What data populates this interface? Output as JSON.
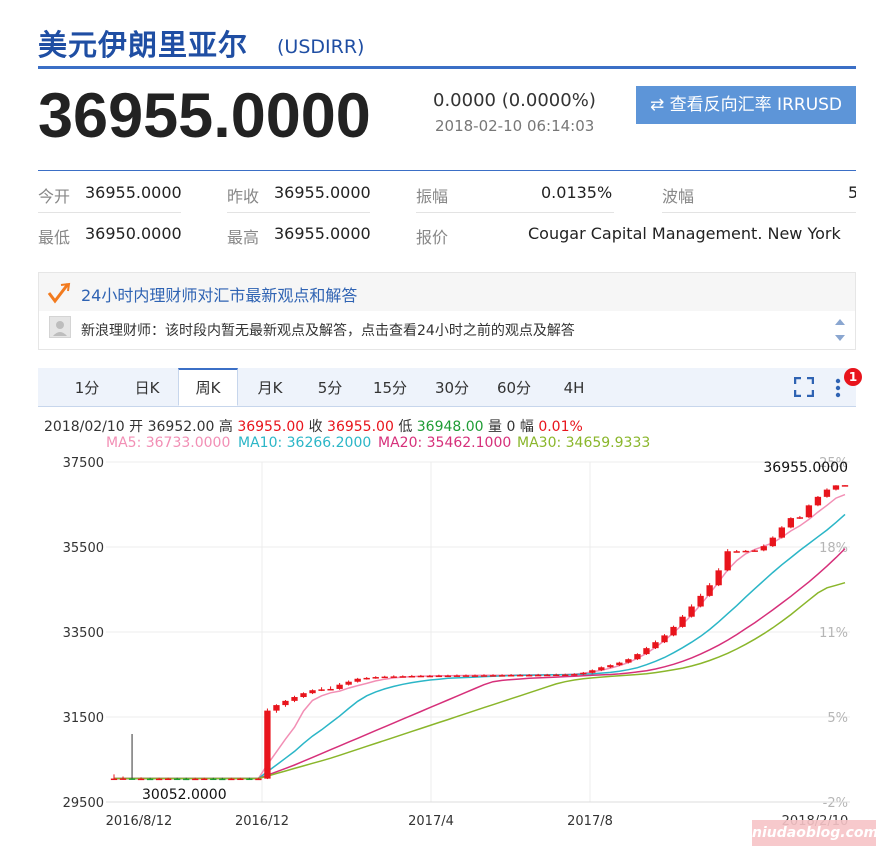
{
  "header": {
    "title": "美元伊朗里亚尔",
    "code": "(USDIRR)",
    "price": "36955.0000",
    "change": "0.0000 (0.0000%)",
    "timestamp": "2018-02-10 06:14:03",
    "reverse_button": "查看反向汇率 IRRUSD"
  },
  "stats": {
    "row1": [
      {
        "label": "今开",
        "value": "36955.0000"
      },
      {
        "label": "昨收",
        "value": "36955.0000"
      },
      {
        "label": "振幅",
        "value": "0.0135%"
      },
      {
        "label": "波幅",
        "value": "5"
      }
    ],
    "row2": [
      {
        "label": "最低",
        "value": "36950.0000"
      },
      {
        "label": "最高",
        "value": "36955.0000"
      },
      {
        "label": "报价",
        "value": "Cougar Capital Management. New York"
      }
    ]
  },
  "advice": {
    "title": "24小时内理财师对汇市最新观点和解答",
    "text": "新浪理财师：该时段内暂无最新观点及解答，点击查看24小时之前的观点及解答"
  },
  "tabs": [
    "1分",
    "日K",
    "周K",
    "月K",
    "5分",
    "15分",
    "30分",
    "60分",
    "4H"
  ],
  "active_tab": "周K",
  "notification_count": "1",
  "ohlc": {
    "date": "2018/02/10",
    "open_label": "开",
    "open": "36952.00",
    "high_label": "高",
    "high": "36955.00",
    "close_label": "收",
    "close": "36955.00",
    "low_label": "低",
    "low": "36948.00",
    "volume_label": "量",
    "volume": "0",
    "range_label": "幅",
    "range": "0.01%"
  },
  "ma_legend": [
    {
      "label": "MA5: 36733.0000",
      "color": "#f28fb5"
    },
    {
      "label": "MA10: 36266.2000",
      "color": "#2bb6c7"
    },
    {
      "label": "MA20: 35462.1000",
      "color": "#d6307a"
    },
    {
      "label": "MA30: 34659.9333",
      "color": "#8ab62b"
    }
  ],
  "colors": {
    "up": "#e8141c",
    "down": "#1f9c35",
    "accent": "#3b6fc6"
  },
  "chart_data": {
    "type": "candlestick",
    "y_ticks": [
      "37500",
      "35500",
      "33500",
      "31500",
      "29500"
    ],
    "ylim": [
      29500,
      37500
    ],
    "pct_ticks": [
      "25%",
      "18%",
      "11%",
      "5%",
      "-2%"
    ],
    "x_ticks": [
      "2016/8/12",
      "2016/12",
      "2017/4",
      "2017/8",
      "2018/2/10"
    ],
    "max_label": "36955.0000",
    "min_label": "30052.0000",
    "grid": true,
    "candles": [
      {
        "o": 30052,
        "h": 30150,
        "l": 30030,
        "c": 30052
      },
      {
        "o": 30052,
        "h": 30100,
        "l": 30040,
        "c": 30055
      },
      {
        "o": 30055,
        "h": 31100,
        "l": 30040,
        "c": 30050
      },
      {
        "o": 30050,
        "h": 30080,
        "l": 30030,
        "c": 30050
      },
      {
        "o": 30050,
        "h": 30070,
        "l": 30030,
        "c": 30048
      },
      {
        "o": 30048,
        "h": 30070,
        "l": 30030,
        "c": 30050
      },
      {
        "o": 30050,
        "h": 30070,
        "l": 30030,
        "c": 30052
      },
      {
        "o": 30052,
        "h": 30070,
        "l": 30030,
        "c": 30050
      },
      {
        "o": 30050,
        "h": 30070,
        "l": 30030,
        "c": 30048
      },
      {
        "o": 30048,
        "h": 30070,
        "l": 30030,
        "c": 30050
      },
      {
        "o": 30050,
        "h": 30070,
        "l": 30030,
        "c": 30052
      },
      {
        "o": 30052,
        "h": 30070,
        "l": 30030,
        "c": 30050
      },
      {
        "o": 30050,
        "h": 30070,
        "l": 30030,
        "c": 30048
      },
      {
        "o": 30048,
        "h": 30070,
        "l": 30030,
        "c": 30050
      },
      {
        "o": 30050,
        "h": 30070,
        "l": 30030,
        "c": 30052
      },
      {
        "o": 30052,
        "h": 30070,
        "l": 30030,
        "c": 30050
      },
      {
        "o": 30050,
        "h": 30070,
        "l": 30030,
        "c": 30050
      },
      {
        "o": 30050,
        "h": 31700,
        "l": 30040,
        "c": 31650
      },
      {
        "o": 31650,
        "h": 31800,
        "l": 31600,
        "c": 31780
      },
      {
        "o": 31780,
        "h": 31900,
        "l": 31740,
        "c": 31880
      },
      {
        "o": 31880,
        "h": 32000,
        "l": 31850,
        "c": 31970
      },
      {
        "o": 31970,
        "h": 32080,
        "l": 31950,
        "c": 32060
      },
      {
        "o": 32060,
        "h": 32150,
        "l": 32040,
        "c": 32130
      },
      {
        "o": 32130,
        "h": 32200,
        "l": 32110,
        "c": 32150
      },
      {
        "o": 32150,
        "h": 32220,
        "l": 32130,
        "c": 32160
      },
      {
        "o": 32160,
        "h": 32300,
        "l": 32140,
        "c": 32260
      },
      {
        "o": 32260,
        "h": 32360,
        "l": 32240,
        "c": 32330
      },
      {
        "o": 32330,
        "h": 32420,
        "l": 32310,
        "c": 32400
      },
      {
        "o": 32400,
        "h": 32440,
        "l": 32380,
        "c": 32420
      },
      {
        "o": 32420,
        "h": 32460,
        "l": 32400,
        "c": 32440
      },
      {
        "o": 32440,
        "h": 32470,
        "l": 32420,
        "c": 32450
      },
      {
        "o": 32450,
        "h": 32480,
        "l": 32430,
        "c": 32455
      },
      {
        "o": 32455,
        "h": 32480,
        "l": 32430,
        "c": 32460
      },
      {
        "o": 32460,
        "h": 32490,
        "l": 32440,
        "c": 32465
      },
      {
        "o": 32465,
        "h": 32490,
        "l": 32440,
        "c": 32470
      },
      {
        "o": 32470,
        "h": 32490,
        "l": 32450,
        "c": 32470
      },
      {
        "o": 32470,
        "h": 32495,
        "l": 32450,
        "c": 32475
      },
      {
        "o": 32475,
        "h": 32495,
        "l": 32455,
        "c": 32475
      },
      {
        "o": 32475,
        "h": 32500,
        "l": 32455,
        "c": 32478
      },
      {
        "o": 32478,
        "h": 32500,
        "l": 32460,
        "c": 32480
      },
      {
        "o": 32480,
        "h": 32500,
        "l": 32460,
        "c": 32480
      },
      {
        "o": 32480,
        "h": 32505,
        "l": 32460,
        "c": 32482
      },
      {
        "o": 32482,
        "h": 32505,
        "l": 32460,
        "c": 32485
      },
      {
        "o": 32485,
        "h": 32505,
        "l": 32465,
        "c": 32485
      },
      {
        "o": 32485,
        "h": 32510,
        "l": 32465,
        "c": 32488
      },
      {
        "o": 32488,
        "h": 32510,
        "l": 32470,
        "c": 32490
      },
      {
        "o": 32490,
        "h": 32510,
        "l": 32470,
        "c": 32490
      },
      {
        "o": 32490,
        "h": 32515,
        "l": 32470,
        "c": 32492
      },
      {
        "o": 32492,
        "h": 32515,
        "l": 32470,
        "c": 32495
      },
      {
        "o": 32495,
        "h": 32520,
        "l": 32475,
        "c": 32498
      },
      {
        "o": 32498,
        "h": 32520,
        "l": 32475,
        "c": 32500
      },
      {
        "o": 32500,
        "h": 32530,
        "l": 32480,
        "c": 32510
      },
      {
        "o": 32510,
        "h": 32560,
        "l": 32490,
        "c": 32540
      },
      {
        "o": 32540,
        "h": 32620,
        "l": 32520,
        "c": 32600
      },
      {
        "o": 32600,
        "h": 32690,
        "l": 32580,
        "c": 32670
      },
      {
        "o": 32670,
        "h": 32740,
        "l": 32650,
        "c": 32720
      },
      {
        "o": 32720,
        "h": 32800,
        "l": 32700,
        "c": 32780
      },
      {
        "o": 32780,
        "h": 32880,
        "l": 32760,
        "c": 32860
      },
      {
        "o": 32860,
        "h": 33000,
        "l": 32840,
        "c": 32980
      },
      {
        "o": 32980,
        "h": 33150,
        "l": 32960,
        "c": 33120
      },
      {
        "o": 33120,
        "h": 33300,
        "l": 33100,
        "c": 33260
      },
      {
        "o": 33260,
        "h": 33450,
        "l": 33240,
        "c": 33420
      },
      {
        "o": 33420,
        "h": 33650,
        "l": 33400,
        "c": 33620
      },
      {
        "o": 33620,
        "h": 33900,
        "l": 33600,
        "c": 33860
      },
      {
        "o": 33860,
        "h": 34150,
        "l": 33840,
        "c": 34100
      },
      {
        "o": 34100,
        "h": 34400,
        "l": 34080,
        "c": 34350
      },
      {
        "o": 34350,
        "h": 34650,
        "l": 34330,
        "c": 34600
      },
      {
        "o": 34600,
        "h": 35000,
        "l": 34580,
        "c": 34950
      },
      {
        "o": 34950,
        "h": 35450,
        "l": 34930,
        "c": 35400
      },
      {
        "o": 35400,
        "h": 35430,
        "l": 35380,
        "c": 35400
      },
      {
        "o": 35400,
        "h": 35430,
        "l": 35380,
        "c": 35410
      },
      {
        "o": 35410,
        "h": 35440,
        "l": 35390,
        "c": 35420
      },
      {
        "o": 35420,
        "h": 35560,
        "l": 35400,
        "c": 35520
      },
      {
        "o": 35520,
        "h": 35750,
        "l": 35500,
        "c": 35720
      },
      {
        "o": 35720,
        "h": 35990,
        "l": 35700,
        "c": 35960
      },
      {
        "o": 35960,
        "h": 36200,
        "l": 35940,
        "c": 36180
      },
      {
        "o": 36180,
        "h": 36230,
        "l": 36160,
        "c": 36200
      },
      {
        "o": 36200,
        "h": 36500,
        "l": 36180,
        "c": 36480
      },
      {
        "o": 36480,
        "h": 36700,
        "l": 36460,
        "c": 36680
      },
      {
        "o": 36680,
        "h": 36880,
        "l": 36660,
        "c": 36850
      },
      {
        "o": 36850,
        "h": 36955,
        "l": 36830,
        "c": 36950
      },
      {
        "o": 36952,
        "h": 36955,
        "l": 36948,
        "c": 36955
      }
    ],
    "series": [
      {
        "name": "MA5",
        "color": "#f28fb5",
        "values": [
          30052,
          30052,
          30052,
          30052,
          30052,
          30052,
          30052,
          30052,
          30052,
          30052,
          30052,
          30052,
          30052,
          30052,
          30052,
          30052,
          30052,
          30380,
          30680,
          30980,
          31260,
          31640,
          31890,
          32000,
          32070,
          32110,
          32180,
          32240,
          32290,
          32350,
          32390,
          32420,
          32440,
          32450,
          32460,
          32465,
          32470,
          32472,
          32475,
          32477,
          32478,
          32480,
          32482,
          32484,
          32486,
          32488,
          32490,
          32492,
          32494,
          32496,
          32500,
          32510,
          32530,
          32560,
          32600,
          32650,
          32710,
          32780,
          32880,
          33000,
          33140,
          33300,
          33480,
          33680,
          33900,
          34140,
          34400,
          34680,
          34960,
          35180,
          35340,
          35440,
          35520,
          35600,
          35730,
          35880,
          36000,
          36150,
          36320,
          36480,
          36650,
          36733
        ]
      },
      {
        "name": "MA10",
        "color": "#2bb6c7",
        "values": [
          30052,
          30052,
          30052,
          30052,
          30052,
          30052,
          30052,
          30052,
          30052,
          30052,
          30052,
          30052,
          30052,
          30052,
          30052,
          30052,
          30052,
          30215,
          30370,
          30530,
          30690,
          30880,
          31050,
          31200,
          31360,
          31520,
          31700,
          31870,
          32000,
          32090,
          32160,
          32220,
          32270,
          32310,
          32340,
          32370,
          32390,
          32410,
          32420,
          32430,
          32440,
          32450,
          32460,
          32468,
          32474,
          32480,
          32484,
          32487,
          32490,
          32493,
          32496,
          32500,
          32508,
          32518,
          32532,
          32550,
          32578,
          32612,
          32660,
          32730,
          32810,
          32900,
          33010,
          33130,
          33260,
          33400,
          33560,
          33740,
          33930,
          34120,
          34320,
          34520,
          34710,
          34900,
          35080,
          35250,
          35420,
          35580,
          35740,
          35900,
          36080,
          36266
        ]
      },
      {
        "name": "MA20",
        "color": "#d6307a",
        "values": [
          30052,
          30052,
          30052,
          30052,
          30052,
          30052,
          30052,
          30052,
          30052,
          30052,
          30052,
          30052,
          30052,
          30052,
          30052,
          30052,
          30052,
          30130,
          30210,
          30290,
          30370,
          30460,
          30550,
          30640,
          30730,
          30820,
          30910,
          31000,
          31090,
          31180,
          31270,
          31360,
          31450,
          31540,
          31630,
          31720,
          31810,
          31900,
          31990,
          32080,
          32170,
          32260,
          32330,
          32360,
          32380,
          32395,
          32410,
          32420,
          32430,
          32440,
          32450,
          32460,
          32470,
          32480,
          32490,
          32500,
          32515,
          32535,
          32560,
          32590,
          32630,
          32680,
          32740,
          32810,
          32890,
          32980,
          33080,
          33190,
          33310,
          33440,
          33580,
          33720,
          33870,
          34020,
          34180,
          34340,
          34510,
          34680,
          34860,
          35050,
          35250,
          35462
        ]
      },
      {
        "name": "MA30",
        "color": "#8ab62b",
        "values": [
          30052,
          30052,
          30052,
          30052,
          30052,
          30052,
          30052,
          30052,
          30052,
          30052,
          30052,
          30052,
          30052,
          30052,
          30052,
          30052,
          30052,
          30110,
          30170,
          30230,
          30290,
          30350,
          30410,
          30470,
          30530,
          30600,
          30670,
          30740,
          30810,
          30880,
          30950,
          31020,
          31090,
          31160,
          31230,
          31300,
          31370,
          31440,
          31510,
          31580,
          31650,
          31720,
          31790,
          31860,
          31930,
          32000,
          32070,
          32140,
          32210,
          32280,
          32330,
          32370,
          32400,
          32420,
          32440,
          32455,
          32470,
          32485,
          32500,
          32520,
          32545,
          32575,
          32610,
          32650,
          32700,
          32760,
          32830,
          32910,
          33000,
          33100,
          33210,
          33330,
          33460,
          33600,
          33750,
          33910,
          34080,
          34250,
          34420,
          34540,
          34600,
          34660
        ]
      }
    ]
  }
}
